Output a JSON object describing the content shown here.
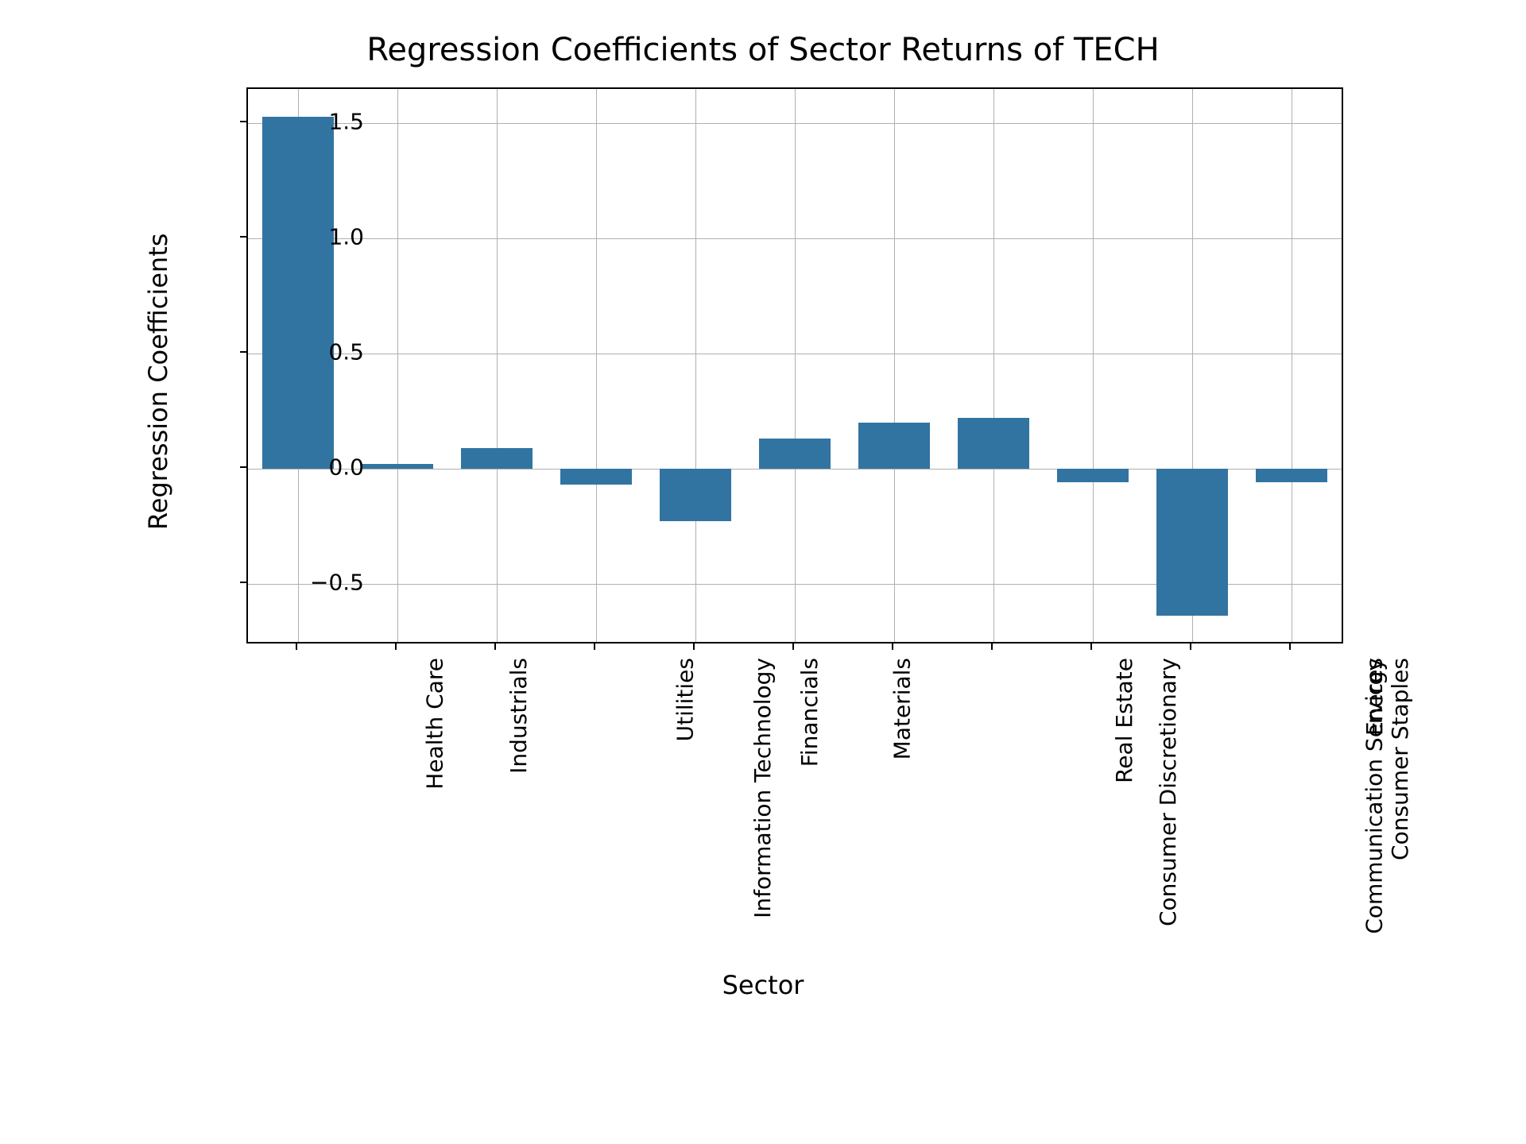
{
  "chart_data": {
    "type": "bar",
    "title": "Regression Coefficients of Sector Returns of TECH",
    "xlabel": "Sector",
    "ylabel": "Regression Coefficients",
    "categories": [
      "Health Care",
      "Industrials",
      "Information Technology",
      "Utilities",
      "Financials",
      "Materials",
      "Consumer Discretionary",
      "Real Estate",
      "Communication Services",
      "Consumer Staples",
      "Energy"
    ],
    "values": [
      1.53,
      0.02,
      0.09,
      -0.07,
      -0.23,
      0.13,
      0.2,
      0.22,
      -0.06,
      -0.64,
      -0.06
    ],
    "ylim": [
      -0.75,
      1.65
    ],
    "yticks": [
      -0.5,
      0.0,
      0.5,
      1.0,
      1.5
    ],
    "ytick_labels": [
      "−0.5",
      "0.0",
      "0.5",
      "1.0",
      "1.5"
    ],
    "bar_color": "#3274a1",
    "grid": true
  }
}
